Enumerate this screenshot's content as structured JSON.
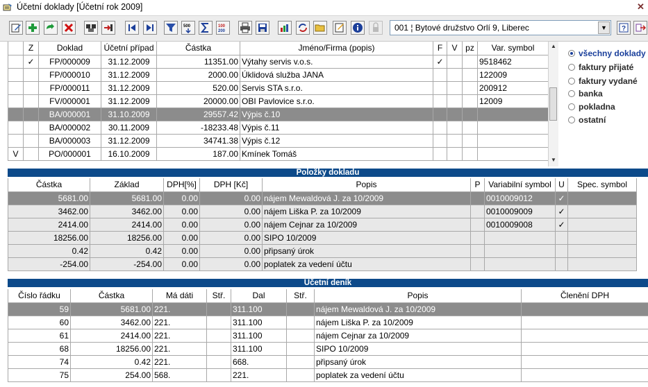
{
  "window": {
    "title": "Účetní doklady",
    "subtitle": "[Účetní rok 2009]"
  },
  "toolbar": {
    "company": "001 ¦ Bytové družstvo Orlí 9, Liberec",
    "buttons": [
      "edit-icon",
      "add-icon",
      "add-copy-icon",
      "delete-icon",
      "search-icon",
      "export-icon",
      "first-icon",
      "last-icon",
      "filter-icon",
      "sum-icon",
      "sigma-icon",
      "calculator-icon",
      "print-icon",
      "save-icon",
      "chart-icon",
      "refresh-icon",
      "open-folder-icon",
      "notes-icon",
      "info-icon",
      "lock-icon"
    ]
  },
  "filters": {
    "selected": "všechny doklady",
    "options": [
      "všechny doklady",
      "faktury přijaté",
      "faktury vydané",
      "banka",
      "pokladna",
      "ostatní"
    ]
  },
  "doklady": {
    "columns": [
      "",
      "Z",
      "Doklad",
      "Účetní případ",
      "Částka",
      "Jméno/Firma (popis)",
      "F",
      "V",
      "pz",
      "Var. symbol"
    ],
    "rows": [
      {
        "mark": "",
        "z": "✓",
        "doklad": "FP/000009",
        "datum": "31.12.2009",
        "castka": "11351.00",
        "nazev": "Výtahy servis v.o.s.",
        "f": "✓",
        "v": "",
        "pz": "",
        "vs": "9518462"
      },
      {
        "mark": "",
        "z": "",
        "doklad": "FP/000010",
        "datum": "31.12.2009",
        "castka": "2000.00",
        "nazev": "Úklidová služba JANA",
        "f": "",
        "v": "",
        "pz": "",
        "vs": "122009"
      },
      {
        "mark": "",
        "z": "",
        "doklad": "FP/000011",
        "datum": "31.12.2009",
        "castka": "520.00",
        "nazev": "Servis STA s.r.o.",
        "f": "",
        "v": "",
        "pz": "",
        "vs": "200912"
      },
      {
        "mark": "",
        "z": "",
        "doklad": "FV/000001",
        "datum": "31.12.2009",
        "castka": "20000.00",
        "nazev": "OBI Pavlovice s.r.o.",
        "f": "",
        "v": "",
        "pz": "",
        "vs": "12009"
      },
      {
        "mark": "",
        "z": "",
        "doklad": "BA/000001",
        "datum": "31.10.2009",
        "castka": "29557.42",
        "nazev": "Výpis č.10",
        "f": "",
        "v": "",
        "pz": "",
        "vs": ""
      },
      {
        "mark": "",
        "z": "",
        "doklad": "BA/000002",
        "datum": "30.11.2009",
        "castka": "-18233.48",
        "nazev": "Výpis č.11",
        "f": "",
        "v": "",
        "pz": "",
        "vs": ""
      },
      {
        "mark": "",
        "z": "",
        "doklad": "BA/000003",
        "datum": "31.12.2009",
        "castka": "34741.38",
        "nazev": "Výpis č.12",
        "f": "",
        "v": "",
        "pz": "",
        "vs": ""
      },
      {
        "mark": "V",
        "z": "",
        "doklad": "PO/000001",
        "datum": "16.10.2009",
        "castka": "187.00",
        "nazev": "Kmínek Tomáš",
        "f": "",
        "v": "",
        "pz": "",
        "vs": ""
      }
    ]
  },
  "polozky": {
    "title": "Položky dokladu",
    "columns": [
      "Částka",
      "Základ",
      "DPH[%]",
      "DPH [Kč]",
      "Popis",
      "P",
      "Variabilní symbol",
      "U",
      "Spec. symbol"
    ],
    "rows": [
      {
        "castka": "5681.00",
        "zaklad": "5681.00",
        "dphp": "0.00",
        "dphk": "0.00",
        "popis": "nájem Mewaldová J. za 10/2009",
        "p": "",
        "vs": "0010009012",
        "u": "✓",
        "ss": ""
      },
      {
        "castka": "3462.00",
        "zaklad": "3462.00",
        "dphp": "0.00",
        "dphk": "0.00",
        "popis": "nájem Liška P.  za 10/2009",
        "p": "",
        "vs": "0010009009",
        "u": "✓",
        "ss": ""
      },
      {
        "castka": "2414.00",
        "zaklad": "2414.00",
        "dphp": "0.00",
        "dphk": "0.00",
        "popis": "nájem Cejnar  za 10/2009",
        "p": "",
        "vs": "0010009008",
        "u": "✓",
        "ss": ""
      },
      {
        "castka": "18256.00",
        "zaklad": "18256.00",
        "dphp": "0.00",
        "dphk": "0.00",
        "popis": "SIPO 10/2009",
        "p": "",
        "vs": "",
        "u": "",
        "ss": ""
      },
      {
        "castka": "0.42",
        "zaklad": "0.42",
        "dphp": "0.00",
        "dphk": "0.00",
        "popis": "připsaný úrok",
        "p": "",
        "vs": "",
        "u": "",
        "ss": ""
      },
      {
        "castka": "-254.00",
        "zaklad": "-254.00",
        "dphp": "0.00",
        "dphk": "0.00",
        "popis": "poplatek za vedení účtu",
        "p": "",
        "vs": "",
        "u": "",
        "ss": ""
      }
    ]
  },
  "denik": {
    "title": "Účetní deník",
    "columns": [
      "Číslo řádku",
      "Částka",
      "Má dáti",
      "Stř.",
      "Dal",
      "Stř.",
      "Popis",
      "Členění DPH"
    ],
    "rows": [
      {
        "radek": "59",
        "castka": "5681.00",
        "md": "221.",
        "str1": "",
        "dal": "311.100",
        "str2": "",
        "popis": "nájem Mewaldová J. za 10/2009",
        "dph": ""
      },
      {
        "radek": "60",
        "castka": "3462.00",
        "md": "221.",
        "str1": "",
        "dal": "311.100",
        "str2": "",
        "popis": "nájem Liška P.  za 10/2009",
        "dph": ""
      },
      {
        "radek": "61",
        "castka": "2414.00",
        "md": "221.",
        "str1": "",
        "dal": "311.100",
        "str2": "",
        "popis": "nájem Cejnar  za 10/2009",
        "dph": ""
      },
      {
        "radek": "68",
        "castka": "18256.00",
        "md": "221.",
        "str1": "",
        "dal": "311.100",
        "str2": "",
        "popis": "SIPO 10/2009",
        "dph": ""
      },
      {
        "radek": "74",
        "castka": "0.42",
        "md": "221.",
        "str1": "",
        "dal": "668.",
        "str2": "",
        "popis": "připsaný úrok",
        "dph": ""
      },
      {
        "radek": "75",
        "castka": "254.00",
        "md": "568.",
        "str1": "",
        "dal": "221.",
        "str2": "",
        "popis": "poplatek za vedení účtu",
        "dph": ""
      }
    ]
  }
}
